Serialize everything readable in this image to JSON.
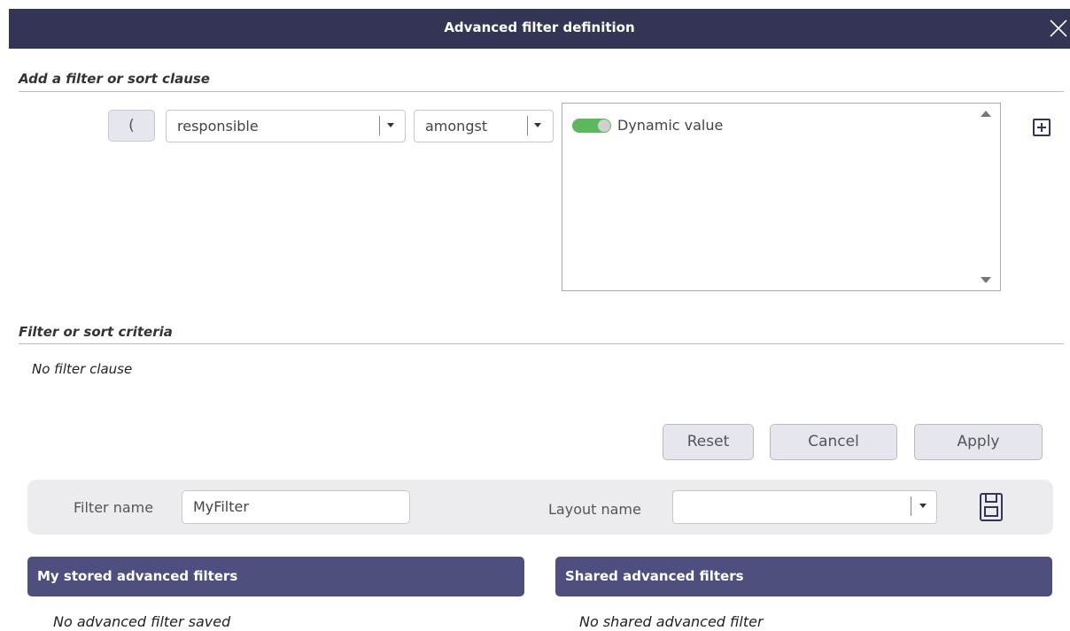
{
  "dialog": {
    "title": "Advanced filter definition"
  },
  "add_clause": {
    "section_title": "Add a filter or sort clause",
    "open_paren_label": "(",
    "field_select_value": "responsible",
    "operator_select_value": "amongst",
    "dynamic_value_label": "Dynamic value",
    "dynamic_value_enabled": true
  },
  "criteria": {
    "section_title": "Filter or sort criteria",
    "empty_text": "No filter clause"
  },
  "actions": {
    "reset_label": "Reset",
    "cancel_label": "Cancel",
    "apply_label": "Apply"
  },
  "save_bar": {
    "filter_name_label": "Filter name",
    "filter_name_value": "MyFilter",
    "layout_name_label": "Layout name",
    "layout_name_value": ""
  },
  "stored": {
    "my_title": "My stored advanced filters",
    "my_empty": "No advanced filter saved",
    "shared_title": "Shared advanced filters",
    "shared_empty": "No shared advanced filter"
  },
  "colors": {
    "title_bar": "#343554",
    "panel_header": "#4e4f7e",
    "toggle_on": "#5cb85c"
  }
}
